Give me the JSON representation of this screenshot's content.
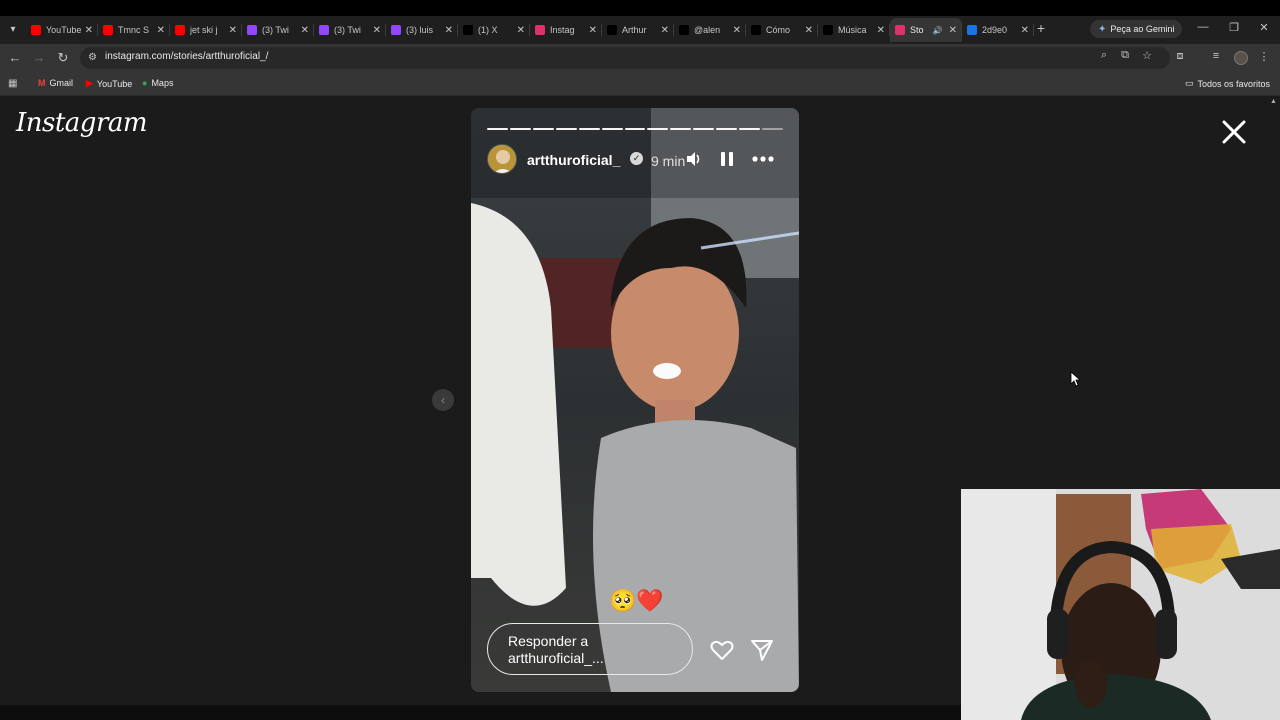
{
  "tabs": [
    {
      "title": "YouTube",
      "favicon": "youtube-icon",
      "color": "#ff0000"
    },
    {
      "title": "Tmnc S",
      "favicon": "youtube-icon",
      "color": "#ff0000"
    },
    {
      "title": "jet ski j",
      "favicon": "youtube-icon",
      "color": "#ff0000"
    },
    {
      "title": "(3) Twi",
      "favicon": "twitch-icon",
      "color": "#9146ff"
    },
    {
      "title": "(3) Twi",
      "favicon": "twitch-icon",
      "color": "#9146ff"
    },
    {
      "title": "(3) luis",
      "favicon": "twitch-icon",
      "color": "#9146ff"
    },
    {
      "title": "(1) X",
      "favicon": "x-icon",
      "color": "#000000"
    },
    {
      "title": "Instag",
      "favicon": "instagram-icon",
      "color": "#e1306c"
    },
    {
      "title": "Arthur",
      "favicon": "tiktok-icon",
      "color": "#000000"
    },
    {
      "title": "@alen",
      "favicon": "tiktok-icon",
      "color": "#000000"
    },
    {
      "title": "Cómo",
      "favicon": "tiktok-icon",
      "color": "#000000"
    },
    {
      "title": "Música",
      "favicon": "tiktok-icon",
      "color": "#000000"
    },
    {
      "title": "Sto",
      "favicon": "instagram-icon",
      "color": "#e1306c",
      "active": true,
      "audio": true
    },
    {
      "title": "2d9e0",
      "favicon": "image-icon",
      "color": "#1a73e8"
    }
  ],
  "gemini_label": "Peça ao Gemini",
  "url": "instagram.com/stories/artthuroficial_/",
  "bookmarks": [
    {
      "label": "Gmail",
      "icon": "gmail-icon"
    },
    {
      "label": "YouTube",
      "icon": "youtube-icon"
    },
    {
      "label": "Maps",
      "icon": "maps-icon"
    }
  ],
  "all_favorites": "Todos os favoritos",
  "logo_text": "Instagram",
  "story": {
    "username": "artthuroficial_",
    "time_ago": "9 min",
    "segments_total": 13,
    "segments_viewed": 12,
    "emojis": "🥺❤️",
    "reply_line1": "Responder a",
    "reply_line2": "artthuroficial_..."
  },
  "colors": {
    "page_bg": "#1b1b1b",
    "chrome_bg": "#1f1f1f",
    "toolbar_bg": "#353535"
  }
}
